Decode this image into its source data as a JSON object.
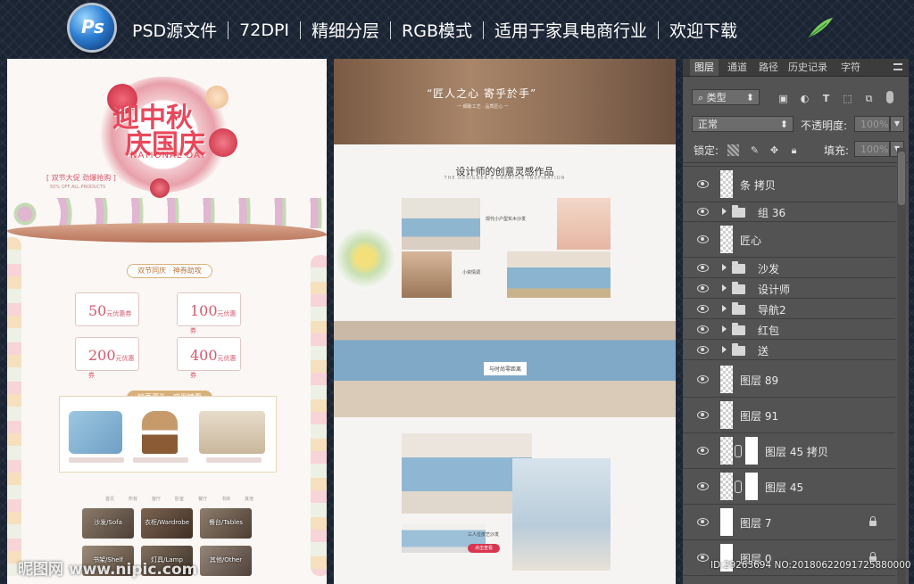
{
  "banner": {
    "ps_logo_text": "Ps",
    "items": [
      "PSD源文件",
      "72DPI",
      "精细分层",
      "RGB模式",
      "适用于家具电商行业",
      "欢迎下载"
    ]
  },
  "page1": {
    "hero_title_1": "迎中秋",
    "hero_title_2": "庆国庆",
    "hero_sub": "NATIONAL DAY",
    "promo": "[ 双节大促  劲爆抢购 ]",
    "promo_en": "50% OFF ALL PRODUCTS",
    "pill1": "双节同庆 · 神券助攻",
    "coupons": [
      {
        "amount": "50",
        "unit": "元优惠券"
      },
      {
        "amount": "100",
        "unit": "元优惠券"
      },
      {
        "amount": "200",
        "unit": "元优惠券"
      },
      {
        "amount": "400",
        "unit": "元优惠券"
      }
    ],
    "pill2": "惊喜豪礼 · 感恩特惠",
    "nav": [
      "首页",
      "所有",
      "客厅",
      "卧室",
      "餐厅",
      "书房",
      "其他"
    ],
    "categories": [
      "沙发/Sofa",
      "衣柜/Wardrobe",
      "餐台/Tables",
      "书架/Shelf",
      "灯具/Lamp",
      "其他/Other"
    ]
  },
  "page2": {
    "quote": "“匠人之心 寄乎於手”",
    "quote_sub": "一 细致工艺 · 品质匠心 一",
    "section_title": "设计师的创意灵感作品",
    "section_en": "THE DESIGNER'S CREATIVE INSPIRATION",
    "label_modern_sofa": "现代小户型实木沙发",
    "label_fresh": "小资情调",
    "label_fashion": "与时尚零距离",
    "label_three_seat": "三人位皮艺沙发",
    "button_buy": "点击查看"
  },
  "layers": {
    "tabs": [
      "图层",
      "通道",
      "路径",
      "历史记录",
      "字符"
    ],
    "filter_kind": "类型",
    "blend_mode": "正常",
    "opacity_label": "不透明度:",
    "opacity_value": "100%",
    "lock_label": "锁定:",
    "fill_label": "填充:",
    "fill_value": "100%",
    "items": [
      {
        "name": "条 拷贝",
        "type": "layer"
      },
      {
        "name": "组 36",
        "type": "group"
      },
      {
        "name": "匠心",
        "type": "layer"
      },
      {
        "name": "沙发",
        "type": "group"
      },
      {
        "name": "设计师",
        "type": "group"
      },
      {
        "name": "导航2",
        "type": "group"
      },
      {
        "name": "红包",
        "type": "group"
      },
      {
        "name": "送",
        "type": "group"
      },
      {
        "name": "图层 89",
        "type": "layer"
      },
      {
        "name": "图层 91",
        "type": "layer"
      },
      {
        "name": "图层 45 拷贝",
        "type": "mask"
      },
      {
        "name": "图层 45",
        "type": "mask"
      },
      {
        "name": "图层 7",
        "type": "locked"
      },
      {
        "name": "图层 0",
        "type": "locked"
      }
    ]
  },
  "watermark": {
    "site": "昵图网 www.nipic.com",
    "id": "ID:29263694 NO:20180622091725880000"
  },
  "colors": {
    "festive_red": "#e8485b",
    "gold": "#d9b07a",
    "ps_panel": "#535353",
    "ps_blue": "#2d7fd3"
  }
}
